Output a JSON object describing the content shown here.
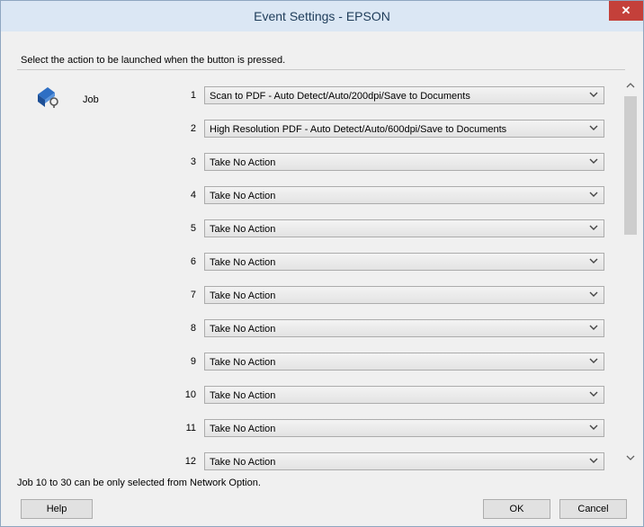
{
  "window": {
    "title": "Event Settings - EPSON",
    "close_label": "✕"
  },
  "instruction": "Select the action to be launched when the button is pressed.",
  "job_label": "Job",
  "rows": [
    {
      "num": "1",
      "value": "Scan to PDF - Auto Detect/Auto/200dpi/Save to Documents"
    },
    {
      "num": "2",
      "value": "High Resolution PDF - Auto Detect/Auto/600dpi/Save to Documents"
    },
    {
      "num": "3",
      "value": "Take No Action"
    },
    {
      "num": "4",
      "value": "Take No Action"
    },
    {
      "num": "5",
      "value": "Take No Action"
    },
    {
      "num": "6",
      "value": "Take No Action"
    },
    {
      "num": "7",
      "value": "Take No Action"
    },
    {
      "num": "8",
      "value": "Take No Action"
    },
    {
      "num": "9",
      "value": "Take No Action"
    },
    {
      "num": "10",
      "value": "Take No Action"
    },
    {
      "num": "11",
      "value": "Take No Action"
    },
    {
      "num": "12",
      "value": "Take No Action"
    }
  ],
  "footnote": "Job 10 to 30 can be only selected from Network Option.",
  "buttons": {
    "help": "Help",
    "ok": "OK",
    "cancel": "Cancel"
  },
  "icons": {
    "job": "scanner-job-icon",
    "dropdown": "chevron-down-icon"
  },
  "colors": {
    "title_bar": "#dbe7f4",
    "close_button": "#c4403a",
    "title_text": "#1e3c5a"
  }
}
